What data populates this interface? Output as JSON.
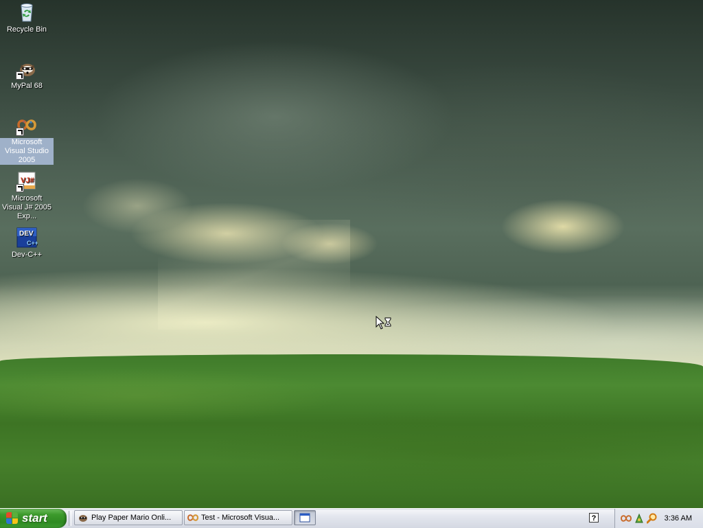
{
  "desktop": {
    "icons": [
      {
        "label": "Recycle Bin",
        "icon": "recycle-bin-icon"
      },
      {
        "label": "MyPal 68",
        "icon": "mypal-browser-icon"
      },
      {
        "label": "Microsoft Visual Studio 2005",
        "icon": "visual-studio-icon"
      },
      {
        "label": "Microsoft Visual J# 2005 Exp...",
        "icon": "visual-jsharp-icon"
      },
      {
        "label": "Dev-C++",
        "icon": "dev-cpp-icon"
      }
    ]
  },
  "taskbar": {
    "start_label": "start",
    "tasks": [
      {
        "label": "Play Paper Mario Onli...",
        "icon": "mypal-browser-icon"
      },
      {
        "label": "Test - Microsoft Visua...",
        "icon": "visual-studio-icon"
      },
      {
        "label": "",
        "icon": "window-icon"
      }
    ],
    "tray": {
      "icons": [
        "help-icon",
        "visual-studio-tray-icon",
        "network-tray-icon",
        "search-tray-icon"
      ],
      "help_glyph": "?",
      "clock": "3:36 AM"
    }
  },
  "cursor": "busy-arrow-cursor"
}
